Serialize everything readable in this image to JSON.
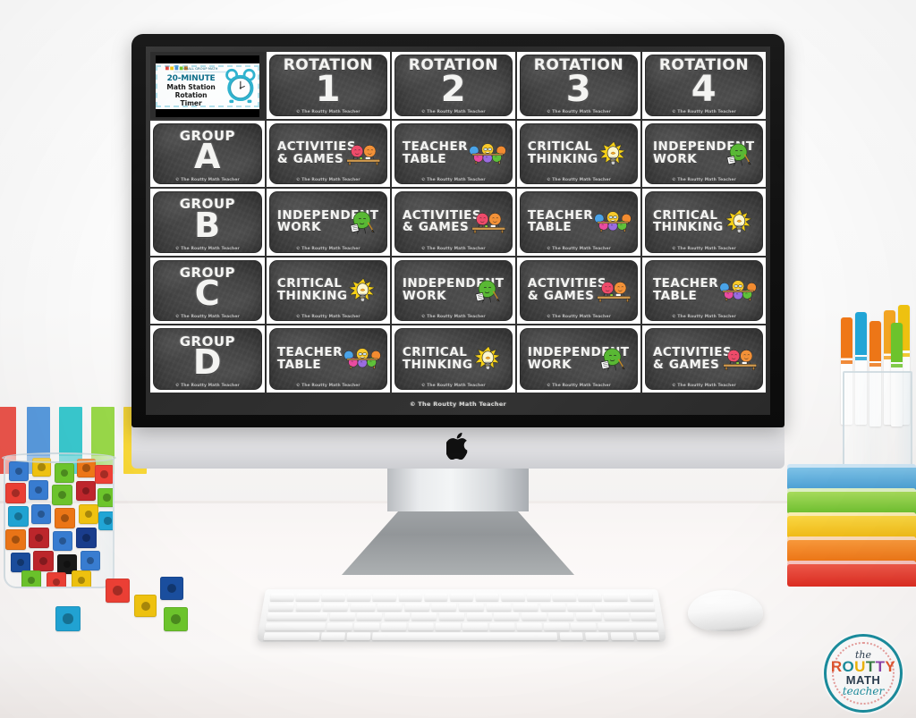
{
  "scene": {
    "description": "imac-desk-scene",
    "device": "iMac desktop computer",
    "apple_logo": "apple-logo",
    "keyboard": "apple-magic-keyboard",
    "mouse": "apple-magic-mouse"
  },
  "board": {
    "copyright": "© The Routty Math Teacher",
    "bottom_caption": "© The Routty Math Teacher",
    "corner_tile": {
      "line1": "20-MINUTE",
      "line2": "Math Station",
      "line3": "Rotation",
      "line4": "Timer",
      "icon": "alarm-clock-icon",
      "logo": "small-group-math-logo"
    },
    "rotation_word": "ROTATION",
    "group_word": "GROUP",
    "rotations": [
      "1",
      "2",
      "3",
      "4"
    ],
    "groups": [
      "A",
      "B",
      "C",
      "D"
    ],
    "stations": {
      "activities": {
        "label": "ACTIVITIES & GAMES",
        "icon": "two-students-at-table-icon"
      },
      "teacher": {
        "label": "TEACHER TABLE",
        "icon": "teacher-and-students-icon"
      },
      "critical": {
        "label": "CRITICAL THINKING",
        "icon": "lightbulb-icon"
      },
      "independent": {
        "label": "INDEPENDENT WORK",
        "icon": "student-with-paper-icon"
      }
    },
    "schedule": [
      {
        "group": "A",
        "cells": [
          "activities",
          "teacher",
          "critical",
          "independent"
        ]
      },
      {
        "group": "B",
        "cells": [
          "independent",
          "activities",
          "teacher",
          "critical"
        ]
      },
      {
        "group": "C",
        "cells": [
          "critical",
          "independent",
          "activities",
          "teacher"
        ]
      },
      {
        "group": "D",
        "cells": [
          "teacher",
          "critical",
          "independent",
          "activities"
        ]
      }
    ]
  },
  "desk_items": {
    "jar": "glass-jar-of-snap-cubes",
    "loose_cubes": "loose-snap-cubes",
    "books": [
      "blue",
      "green",
      "yellow",
      "orange",
      "red"
    ],
    "markers": "cup-of-markers",
    "stripes": "striped-paper-backdrop"
  },
  "watermark": {
    "the": "the",
    "routty": "ROUTTY",
    "math": "MATH",
    "teacher": "teacher",
    "ring_color": "#1b8fa0"
  },
  "palette": {
    "chalk": "#f4f4f2",
    "board": "#3b3b3b",
    "bezel": "#111111",
    "teal": "#1b8fa0",
    "bulb": "#f7d117"
  }
}
